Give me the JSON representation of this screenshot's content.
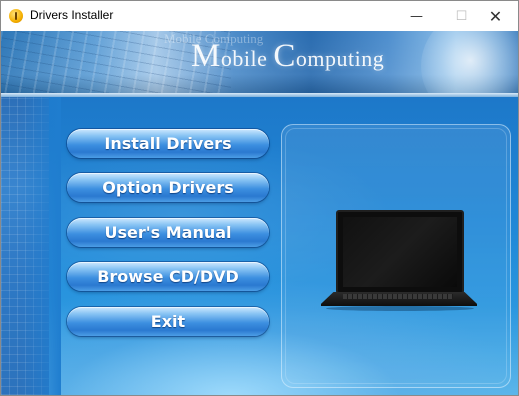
{
  "window": {
    "title": "Drivers Installer",
    "controls": {
      "minimize": "—",
      "maximize": "☐",
      "close": "✕"
    }
  },
  "banner": {
    "title_big_m": "M",
    "title_rest_1": "obile ",
    "title_big_c": "C",
    "title_rest_2": "omputing",
    "ghost_text": "Mobile Computing"
  },
  "menu": {
    "items": [
      {
        "label": "Install Drivers"
      },
      {
        "label": "Option Drivers"
      },
      {
        "label": "User's Manual"
      },
      {
        "label": "Browse CD/DVD"
      },
      {
        "label": "Exit"
      }
    ]
  },
  "preview": {
    "image": "laptop-icon"
  },
  "colors": {
    "panel_blue": "#1f86d6",
    "button_blue": "#2a79d0",
    "button_text": "#ffffff"
  }
}
